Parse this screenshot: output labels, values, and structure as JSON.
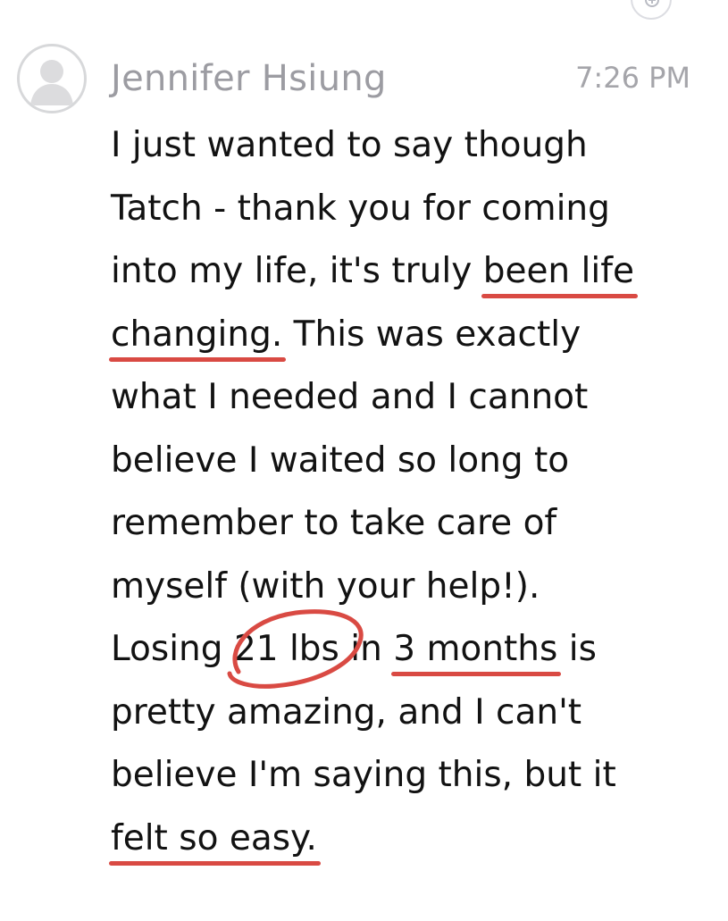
{
  "message": {
    "sender": "Jennifer Hsiung",
    "time": "7:26 PM",
    "lines": [
      "I just wanted to say though",
      "Tatch - thank you for coming",
      "into my life, it's truly ",
      "been life",
      "changing.",
      " This was exactly",
      "what I needed and I cannot",
      "believe I waited so long to",
      "remember to take care of",
      "myself (with your help!).",
      "Losing ",
      "21 lbs",
      " in ",
      "3 months",
      " is",
      "pretty amazing, and I can't",
      "believe I'm saying this, but it",
      "felt so easy."
    ]
  },
  "icons": {
    "avatar": "person-placeholder-icon",
    "corner_button": "add-icon"
  },
  "colors": {
    "annotation": "#d94a43",
    "text": "#121212",
    "secondary_text": "#9c9ca2"
  }
}
